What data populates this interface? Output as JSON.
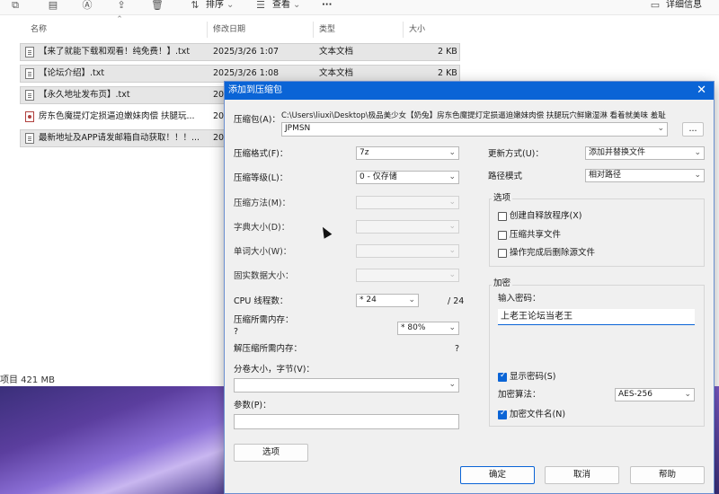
{
  "toolbar": {
    "sort_label": "排序",
    "view_label": "查看",
    "more_label": "···",
    "details_label": "详细信息"
  },
  "columns": {
    "name": "名称",
    "date": "修改日期",
    "type": "类型",
    "size": "大小"
  },
  "files": [
    {
      "name": "【来了就能下载和观看！纯免费！】.txt",
      "date": "2025/3/26 1:07",
      "type": "文本文档",
      "size": "2 KB"
    },
    {
      "name": "【论坛介绍】.txt",
      "date": "2025/3/26 1:08",
      "type": "文本文档",
      "size": "2 KB"
    },
    {
      "name": "【永久地址发布页】.txt",
      "date": "20",
      "type": "",
      "size": ""
    },
    {
      "name": "房东色魔提灯定损逼迫嫩妹肉偿 扶腿玩...",
      "date": "20",
      "type": "",
      "size": ""
    },
    {
      "name": "最新地址及APP请发邮箱自动获取！！！...",
      "date": "20",
      "type": "",
      "size": ""
    }
  ],
  "statusbar": {
    "text": "项目  421 MB"
  },
  "dialog": {
    "title": "添加到压缩包",
    "archive_label": "压缩包(A)：",
    "archive_path": "C:\\Users\\liuxi\\Desktop\\极品美少女【奶兔】房东色魔提灯定损逼迫嫩妹肉偿 扶腿玩穴鲜嫩湿淋 看着就美味 羞耻",
    "archive_name": "JPMSN",
    "browse_label": "...",
    "left": {
      "format_label": "压缩格式(F)：",
      "format_value": "7z",
      "level_label": "压缩等级(L)：",
      "level_value": "0 - 仅存储",
      "method_label": "压缩方法(M)：",
      "dict_label": "字典大小(D)：",
      "word_label": "单词大小(W)：",
      "solid_label": "固实数据大小：",
      "cpu_label": "CPU 线程数：",
      "cpu_value": "* 24",
      "cpu_total": "/ 24",
      "mem_label": "压缩所需内存：",
      "mem_q": "?",
      "mem_value": "* 80%",
      "demem_label": "解压缩所需内存：",
      "demem_q": "?",
      "volume_label": "分卷大小，字节(V)：",
      "params_label": "参数(P)：",
      "options_button": "选项"
    },
    "right": {
      "update_label": "更新方式(U)：",
      "update_value": "添加并替换文件",
      "path_label": "路径模式",
      "path_value": "相对路径",
      "options_group": "选项",
      "opt_sfx": "创建自释放程序(X)",
      "opt_shared": "压缩共享文件",
      "opt_delete": "操作完成后删除源文件",
      "enc_group": "加密",
      "pw_label": "输入密码：",
      "pw_value": "上老王论坛当老王",
      "show_pw": "显示密码(S)",
      "enc_method_label": "加密算法：",
      "enc_method_value": "AES-256",
      "enc_names": "加密文件名(N)"
    },
    "ok": "确定",
    "cancel": "取消",
    "help": "帮助"
  }
}
